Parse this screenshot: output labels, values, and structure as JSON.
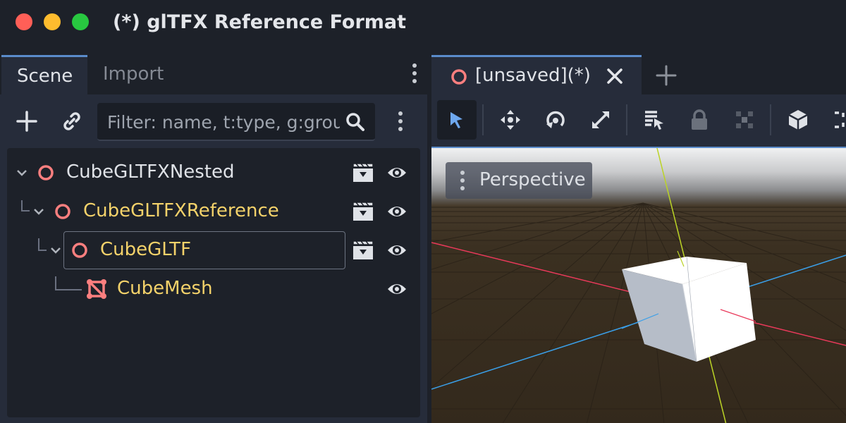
{
  "window": {
    "title": "(*) glTFX Reference Format"
  },
  "left_dock": {
    "tabs": [
      {
        "label": "Scene",
        "active": true
      },
      {
        "label": "Import",
        "active": false
      }
    ],
    "toolbar": {
      "filter_placeholder": "Filter: name, t:type, g:group"
    },
    "tree": [
      {
        "name": "CubeGLTFXNested",
        "icon": "node3d-icon",
        "expanded": true,
        "scene_button": true,
        "visible": true
      },
      {
        "name": "CubeGLTFXReference",
        "icon": "node3d-icon",
        "expanded": true,
        "scene_button": true,
        "visible": true
      },
      {
        "name": "CubeGLTF",
        "icon": "node3d-icon",
        "expanded": true,
        "scene_button": true,
        "visible": true,
        "selected": true
      },
      {
        "name": "CubeMesh",
        "icon": "mesh-instance-icon",
        "expanded": false,
        "scene_button": false,
        "visible": true
      }
    ]
  },
  "editor": {
    "tab": {
      "label": "[unsaved](*)"
    },
    "viewport": {
      "label": "Perspective"
    }
  },
  "colors": {
    "accent": "#5a8ccb",
    "node_icon": "#fc7f7f",
    "instance_text": "#f4d26a",
    "x_axis": "#e9395a",
    "y_axis": "#bbd326",
    "z_axis": "#3a9fe8"
  }
}
